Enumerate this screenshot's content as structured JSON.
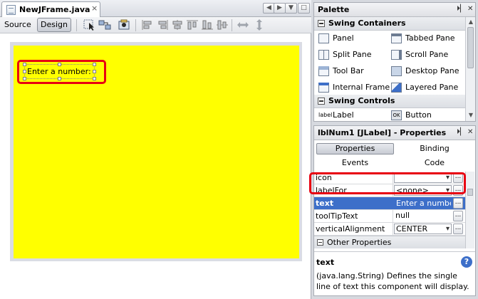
{
  "editor": {
    "tab_title": "NewJFrame.java",
    "tab_close": "×",
    "source_label": "Source",
    "design_label": "Design",
    "nav_buttons": [
      "◀",
      "▶",
      "▼",
      "□"
    ]
  },
  "form": {
    "background_color": "#ffff00",
    "label_text": "Enter a number:",
    "highlight_color": "#e80012"
  },
  "palette": {
    "title": "Palette",
    "categories": [
      {
        "label": "Swing Containers",
        "items": [
          "Panel",
          "Tabbed Pane",
          "Split Pane",
          "Scroll Pane",
          "Tool Bar",
          "Desktop Pane",
          "Internal Frame",
          "Layered Pane"
        ]
      },
      {
        "label": "Swing Controls",
        "items": [
          "Label",
          "Button"
        ]
      }
    ]
  },
  "properties": {
    "title": "lblNum1 [JLabel] - Properties",
    "tabs": [
      "Properties",
      "Binding",
      "Events",
      "Code"
    ],
    "rows": [
      {
        "name": "icon",
        "value": ""
      },
      {
        "name": "labelFor",
        "value": "<none>"
      },
      {
        "name": "text",
        "value": "Enter a number:",
        "selected": true
      },
      {
        "name": "toolTipText",
        "value": "null"
      },
      {
        "name": "verticalAlignment",
        "value": "CENTER"
      }
    ],
    "other_section": "Other Properties",
    "ellipsis": "...",
    "selected_color": "#3d6fc9",
    "description_title": "text",
    "description_body": "(java.lang.String) Defines the single line of text this component will display."
  },
  "icons": [
    "doc-icon",
    "selection-mode-icon",
    "connection-mode-icon",
    "preview-icon",
    "align-icons",
    "resize-icons",
    "minimize-icon",
    "close-icon",
    "help-icon"
  ]
}
